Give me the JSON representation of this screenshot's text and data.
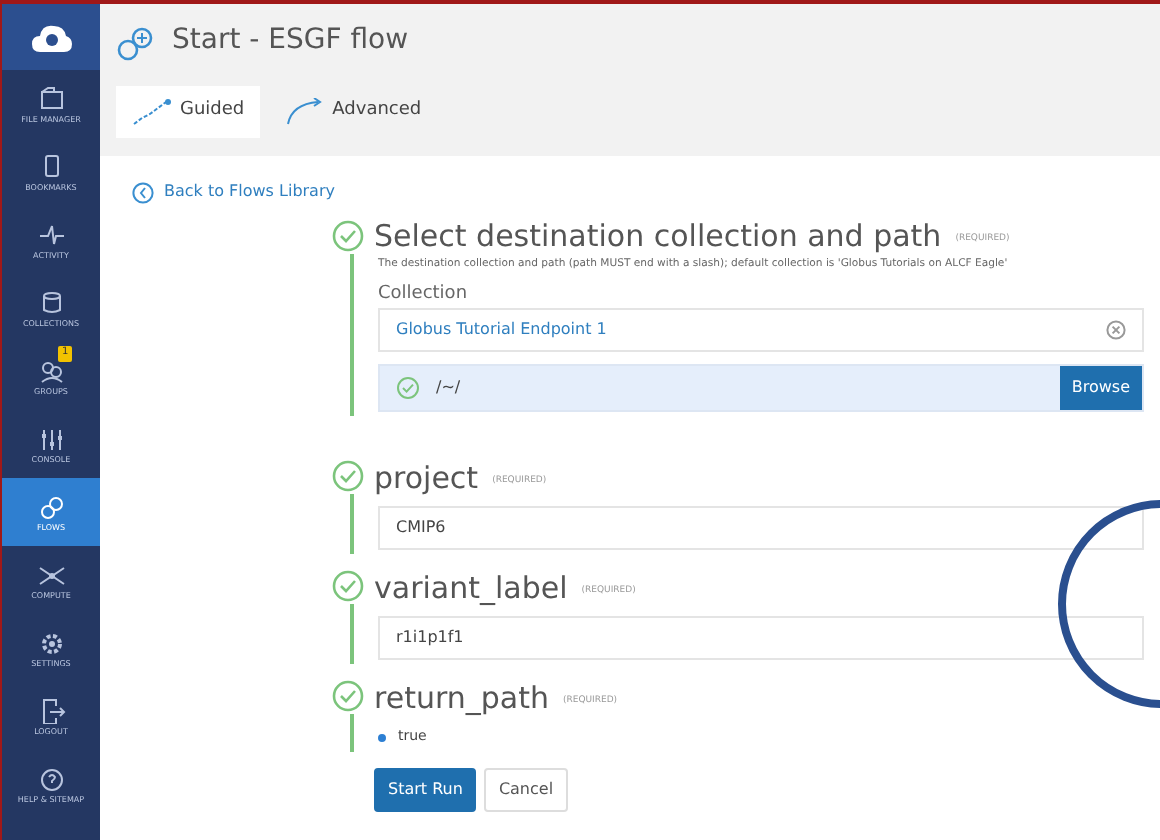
{
  "sidebar": {
    "items": [
      {
        "label": "FILE MANAGER",
        "selected": false
      },
      {
        "label": "BOOKMARKS",
        "selected": false
      },
      {
        "label": "ACTIVITY",
        "selected": false
      },
      {
        "label": "COLLECTIONS",
        "selected": false
      },
      {
        "label": "GROUPS",
        "selected": false,
        "badge": "1"
      },
      {
        "label": "CONSOLE",
        "selected": false
      },
      {
        "label": "FLOWS",
        "selected": true
      },
      {
        "label": "COMPUTE",
        "selected": false
      },
      {
        "label": "SETTINGS",
        "selected": false
      },
      {
        "label": "LOGOUT",
        "selected": false
      },
      {
        "label": "HELP & SITEMAP",
        "selected": false
      }
    ]
  },
  "page": {
    "title": "Start - ESGF flow"
  },
  "tabs": [
    {
      "label": "Guided",
      "selected": true
    },
    {
      "label": "Advanced",
      "selected": false
    }
  ],
  "back_link": "Back to Flows Library",
  "steps": [
    {
      "kind": "collection",
      "title": "Select destination collection and path",
      "required": "(REQUIRED)",
      "description": "The destination collection and path (path MUST end with a slash); default collection is 'Globus Tutorials on ALCF Eagle'",
      "field_label": "Collection",
      "collection": "Globus Tutorial Endpoint 1",
      "path": "/~/",
      "browse_button": "Browse"
    },
    {
      "kind": "text",
      "title": "project",
      "required": "(REQUIRED)",
      "value": "CMIP6"
    },
    {
      "kind": "text",
      "title": "variant_label",
      "required": "(REQUIRED)",
      "value": "r1i1p1f1"
    },
    {
      "kind": "radio",
      "title": "return_path",
      "required": "(REQUIRED)",
      "option": "true",
      "selected": true
    }
  ],
  "buttons": [
    {
      "label": "Start Run",
      "kind": "primary"
    },
    {
      "label": "Cancel",
      "kind": "secondary"
    }
  ]
}
